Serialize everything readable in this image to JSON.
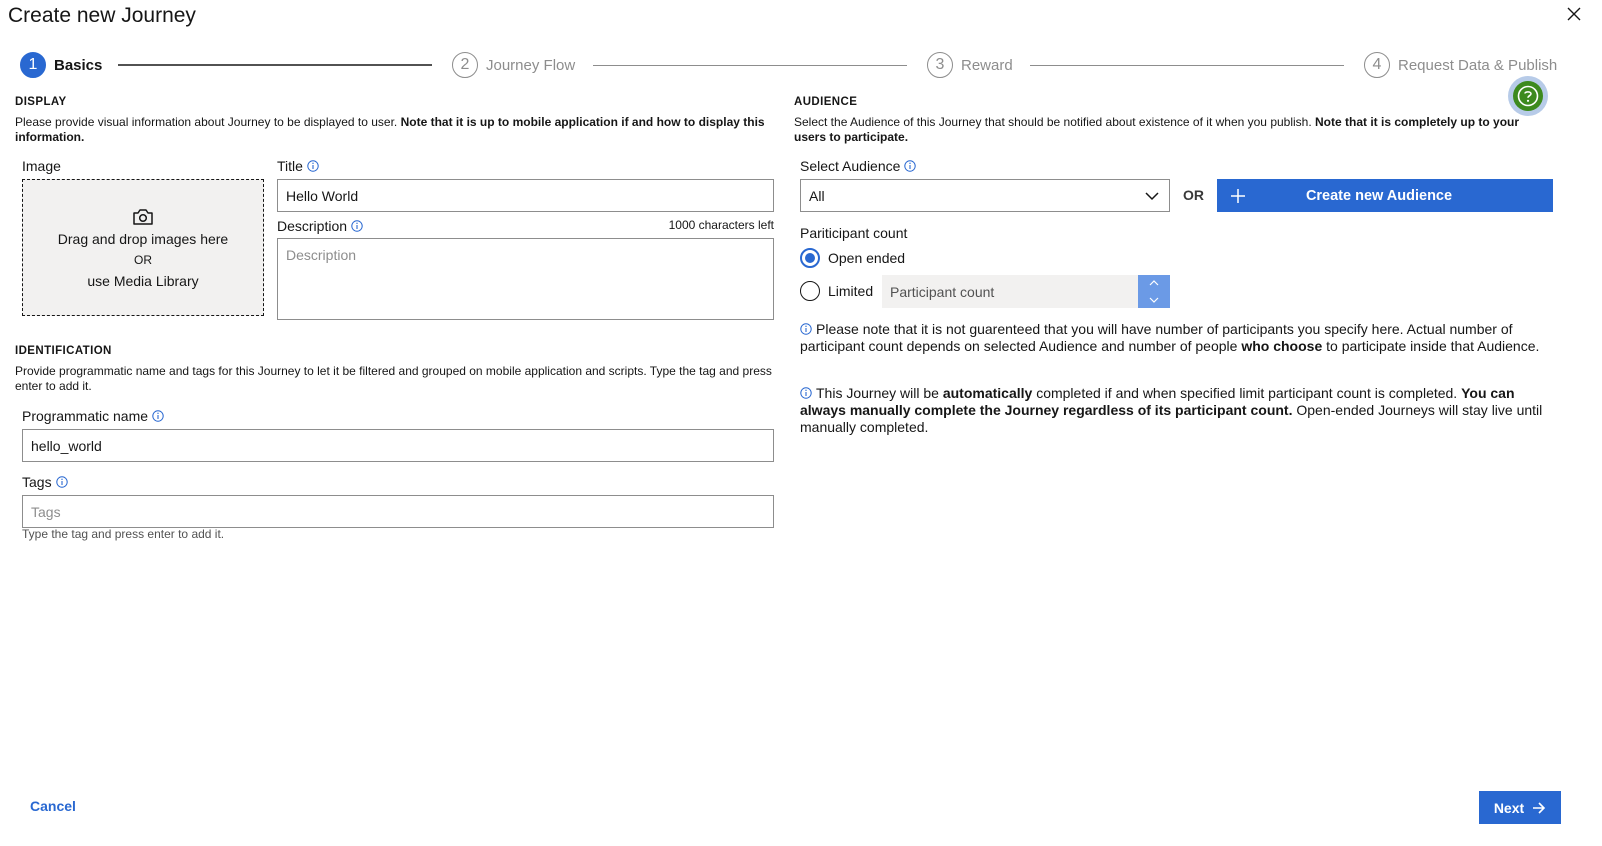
{
  "dialog": {
    "title": "Create new Journey"
  },
  "stepper": {
    "steps": [
      {
        "number": "1",
        "label": "Basics"
      },
      {
        "number": "2",
        "label": "Journey Flow"
      },
      {
        "number": "3",
        "label": "Reward"
      },
      {
        "number": "4",
        "label": "Request Data & Publish"
      }
    ]
  },
  "display": {
    "title": "DISPLAY",
    "desc_plain": "Please provide visual information about Journey to be displayed to user. ",
    "desc_bold": "Note that it is up to mobile application if and how to display this information.",
    "image_label": "Image",
    "dropzone_text": "Drag and drop images here",
    "dropzone_or": "OR",
    "dropzone_link": "use Media Library",
    "title_label": "Title",
    "title_value": "Hello World",
    "description_label": "Description",
    "description_counter": "1000 characters left",
    "description_placeholder": "Description"
  },
  "identification": {
    "title": "IDENTIFICATION",
    "desc": "Provide programmatic name and tags for this Journey to let it be filtered and grouped on mobile application and scripts. Type the tag and press enter to add it.",
    "programmatic_label": "Programmatic name",
    "programmatic_value": "hello_world",
    "tags_label": "Tags",
    "tags_placeholder": "Tags",
    "tags_helper": "Type the tag and press enter to add it."
  },
  "audience": {
    "title": "AUDIENCE",
    "desc_plain": "Select the Audience of this Journey that should be notified about existence of it when you publish. ",
    "desc_bold": "Note that it is completely up to your users to participate.",
    "select_label": "Select Audience",
    "select_value": "All",
    "or_text": "OR",
    "create_button": "Create new Audience",
    "participant_label": "Pariticipant count",
    "open_ended_label": "Open ended",
    "limited_label": "Limited",
    "participant_placeholder": "Participant count",
    "note1_a": "Please note that it is not guarenteed that you will have number of participants you specify here. Actual number of participant count depends on selected Audience and number of people ",
    "note1_b": "who choose",
    "note1_c": " to participate inside that Audience.",
    "note2_a": "This Journey will be ",
    "note2_b": "automatically",
    "note2_c": " completed if and when specified limit participant count is completed. ",
    "note2_d": "You can always manually complete the Journey regardless of its participant count.",
    "note2_e": " Open-ended Journeys will stay live until manually completed."
  },
  "footer": {
    "cancel": "Cancel",
    "next": "Next"
  },
  "colors": {
    "primary": "#2968d1",
    "help_green": "#3d8a1e"
  },
  "icons": [
    "close-icon",
    "camera-icon",
    "info-icon",
    "chevron-down-icon",
    "plus-icon",
    "help-icon",
    "arrow-right-icon"
  ]
}
